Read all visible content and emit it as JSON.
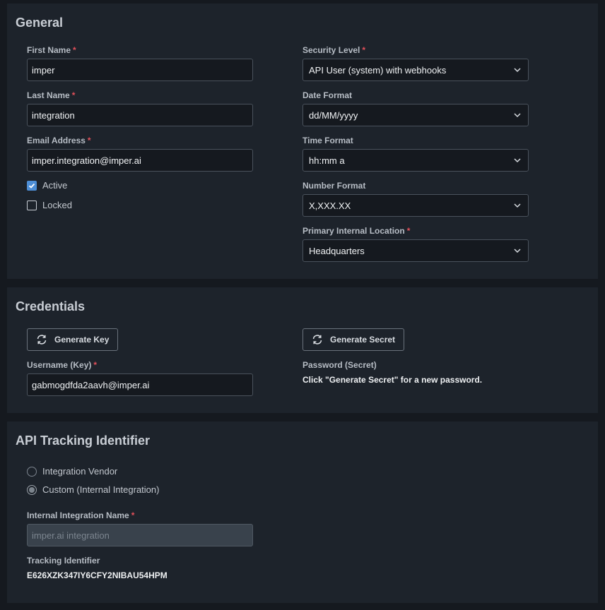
{
  "general": {
    "title": "General",
    "first_name": {
      "label": "First Name",
      "value": "imper"
    },
    "last_name": {
      "label": "Last Name",
      "value": "integration"
    },
    "email": {
      "label": "Email Address",
      "value": "imper.integration@imper.ai"
    },
    "active": {
      "label": "Active",
      "checked": true
    },
    "locked": {
      "label": "Locked",
      "checked": false
    },
    "security_level": {
      "label": "Security Level",
      "value": "API User (system) with webhooks"
    },
    "date_format": {
      "label": "Date Format",
      "value": "dd/MM/yyyy"
    },
    "time_format": {
      "label": "Time Format",
      "value": "hh:mm a"
    },
    "number_format": {
      "label": "Number Format",
      "value": "X,XXX.XX"
    },
    "primary_location": {
      "label": "Primary Internal Location",
      "value": "Headquarters"
    }
  },
  "credentials": {
    "title": "Credentials",
    "generate_key_label": "Generate Key",
    "generate_secret_label": "Generate Secret",
    "username": {
      "label": "Username (Key)",
      "value": "gabmogdfda2aavh@imper.ai"
    },
    "password": {
      "label": "Password (Secret)",
      "hint": "Click \"Generate Secret\" for a new password."
    }
  },
  "api_tracking": {
    "title": "API Tracking Identifier",
    "options": [
      {
        "label": "Integration Vendor",
        "selected": false
      },
      {
        "label": "Custom (Internal Integration)",
        "selected": true
      }
    ],
    "internal_name": {
      "label": "Internal Integration Name",
      "placeholder": "imper.ai integration"
    },
    "tracking_identifier": {
      "label": "Tracking Identifier",
      "value": "E626XZK347IY6CFY2NIBAU54HPM"
    }
  },
  "colors": {
    "background": "#15191f",
    "panel": "#1d232b",
    "accent": "#4d8ed6",
    "required": "#e2505a"
  }
}
